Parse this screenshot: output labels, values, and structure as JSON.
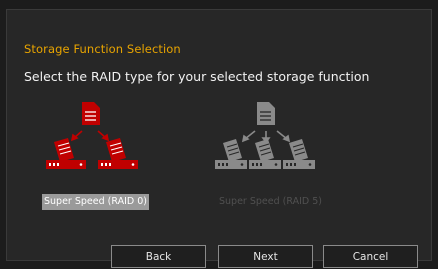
{
  "dialog": {
    "section_title": "Storage Function Selection",
    "prompt": "Select the RAID type for your selected storage function"
  },
  "raid_options": [
    {
      "label": "Super Speed (RAID 0)",
      "selected": true,
      "color": "#c00000"
    },
    {
      "label": "Super Speed (RAID 5)",
      "selected": false,
      "color": "#8a8a8a"
    }
  ],
  "buttons": {
    "back": "Back",
    "next": "Next",
    "cancel": "Cancel"
  },
  "colors": {
    "accent": "#e8a400",
    "selected_icon": "#c00000",
    "disabled_icon": "#8a8a8a"
  }
}
